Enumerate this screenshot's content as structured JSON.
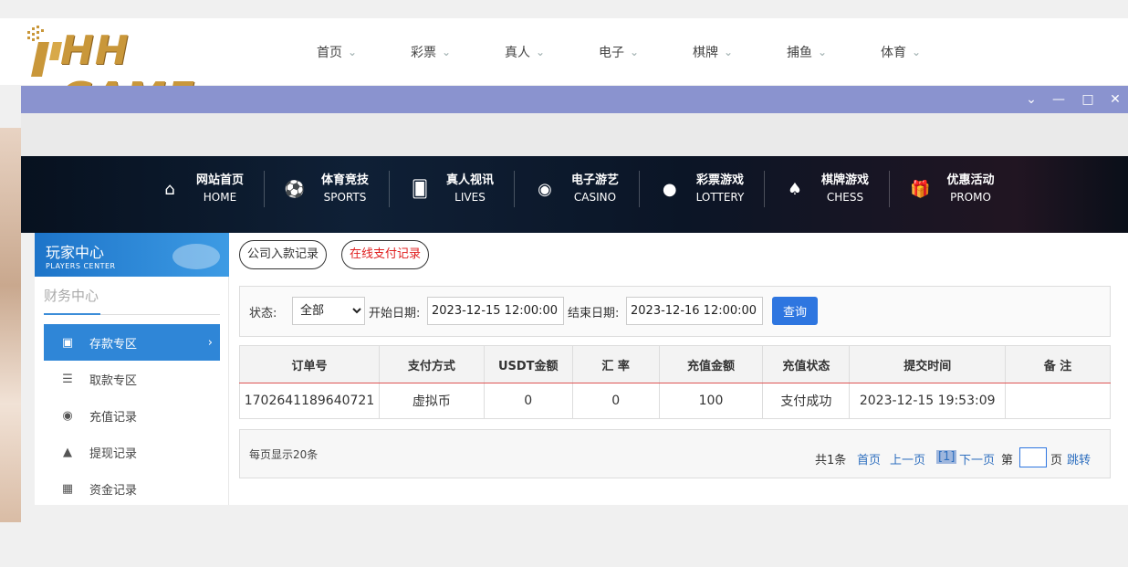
{
  "logo": {
    "text": "HH GAME"
  },
  "topnav": [
    {
      "label": "首页"
    },
    {
      "label": "彩票"
    },
    {
      "label": "真人"
    },
    {
      "label": "电子"
    },
    {
      "label": "棋牌"
    },
    {
      "label": "捕鱼"
    },
    {
      "label": "体育"
    }
  ],
  "window": {
    "controls": [
      "chevron-down",
      "minimize",
      "maximize",
      "close"
    ]
  },
  "banner_nav": [
    {
      "cn": "网站首页",
      "en": "HOME",
      "icon": "home-icon"
    },
    {
      "cn": "体育竞技",
      "en": "SPORTS",
      "icon": "ball-icon"
    },
    {
      "cn": "真人视讯",
      "en": "LIVES",
      "icon": "cards-icon"
    },
    {
      "cn": "电子游艺",
      "en": "CASINO",
      "icon": "slot-icon"
    },
    {
      "cn": "彩票游戏",
      "en": "LOTTERY",
      "icon": "lottery-icon"
    },
    {
      "cn": "棋牌游戏",
      "en": "CHESS",
      "icon": "spade-icon"
    },
    {
      "cn": "优惠活动",
      "en": "PROMO",
      "icon": "gift-icon"
    }
  ],
  "sidebar": {
    "title_cn": "玩家中心",
    "title_en": "PLAYERS CENTER",
    "section": "财务中心",
    "items": [
      {
        "label": "存款专区",
        "active": true,
        "icon": "card-icon"
      },
      {
        "label": "取款专区",
        "active": false,
        "icon": "hand-money-icon"
      },
      {
        "label": "充值记录",
        "active": false,
        "icon": "money-bag-icon"
      },
      {
        "label": "提现记录",
        "active": false,
        "icon": "withdraw-icon"
      },
      {
        "label": "资金记录",
        "active": false,
        "icon": "ledger-icon"
      }
    ]
  },
  "tabs": [
    {
      "label": "公司入款记录",
      "color": "#333333"
    },
    {
      "label": "在线支付记录",
      "color": "#e02020"
    }
  ],
  "filter": {
    "status_label": "状态:",
    "status_value": "全部",
    "start_label": "开始日期:",
    "start_value": "2023-12-15 12:00:00",
    "end_label": "结束日期:",
    "end_value": "2023-12-16 12:00:00",
    "query_label": "查询"
  },
  "table": {
    "headers": [
      "订单号",
      "支付方式",
      "USDT金额",
      "汇 率",
      "充值金额",
      "充值状态",
      "提交时间",
      "备 注"
    ],
    "rows": [
      [
        "1702641189640721",
        "虚拟币",
        "0",
        "0",
        "100",
        "支付成功",
        "2023-12-15 19:53:09",
        ""
      ]
    ]
  },
  "pager": {
    "per_page": "每页显示20条",
    "total": "共1条",
    "first": "首页",
    "prev": "上一页",
    "current": "[1]",
    "next": "下一页",
    "page_prefix": "第",
    "page_suffix": "页",
    "jump": "跳转"
  }
}
